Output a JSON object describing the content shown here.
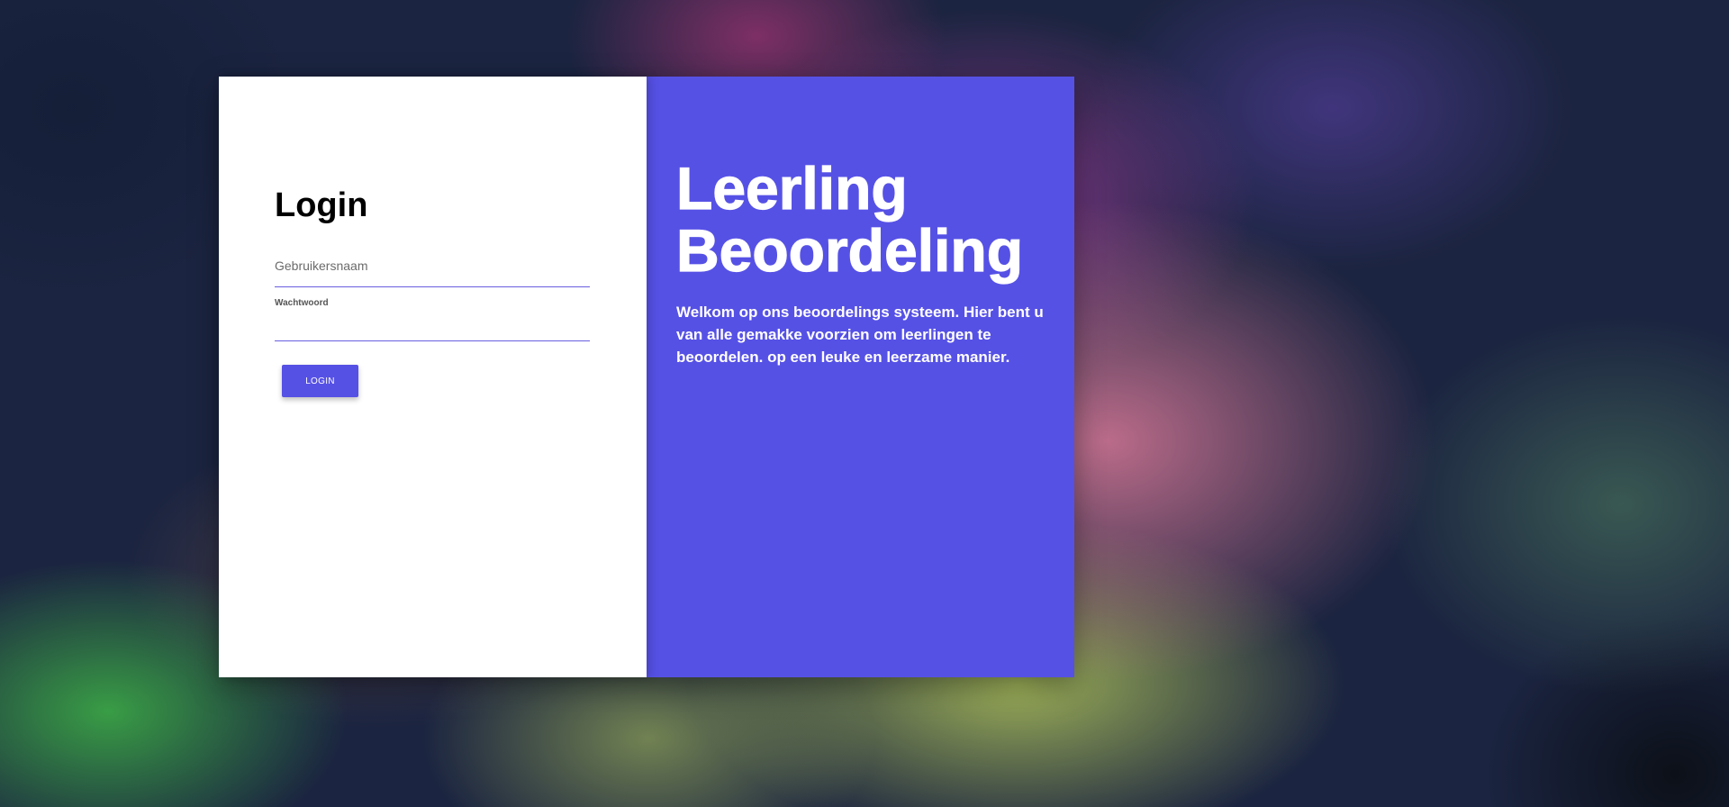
{
  "colors": {
    "accent": "#5651e5",
    "panel_bg": "#ffffff",
    "text_on_accent": "#ffffff"
  },
  "login": {
    "title": "Login",
    "username_placeholder": "Gebruikersnaam",
    "password_label": "Wachtwoord",
    "password_value": "",
    "button_label": "LOGIN"
  },
  "info": {
    "title_line1": "Leerling",
    "title_line2": "Beoordeling",
    "description": "Welkom op ons beoordelings systeem. Hier bent u van alle gemakke voorzien om leerlingen te beoordelen. op een leuke en leerzame manier."
  }
}
